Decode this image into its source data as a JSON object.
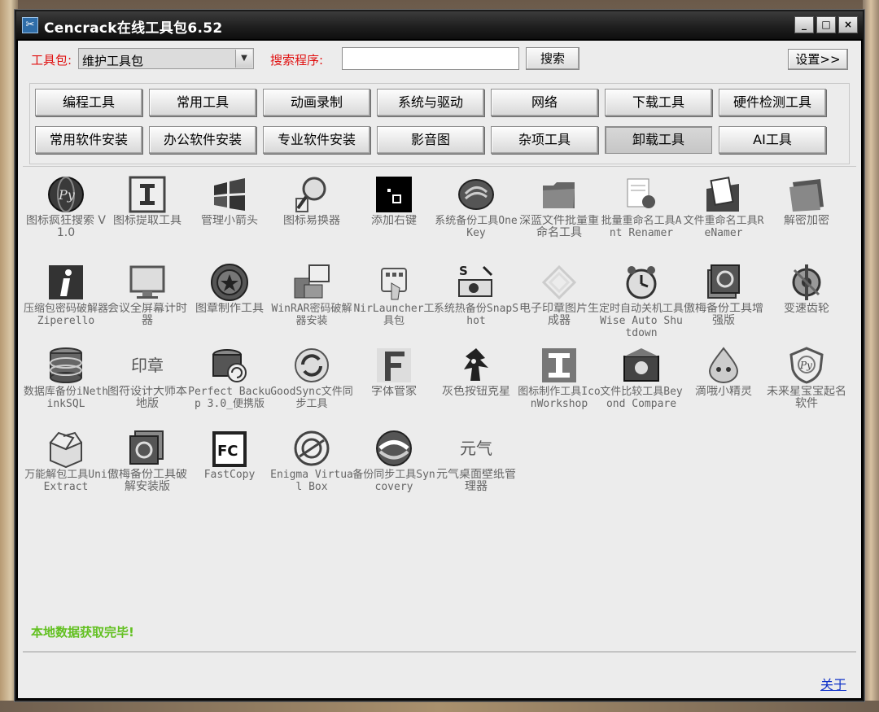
{
  "window": {
    "title": "Cencrack在线工具包6.52",
    "buttons": [
      "_",
      "□",
      "×"
    ]
  },
  "toolbar": {
    "package_label": "工具包:",
    "package_value": "维护工具包",
    "search_label": "搜索程序:",
    "search_value": "",
    "search_button": "搜索",
    "settings_button": "设置>>"
  },
  "categories": {
    "row1": [
      "编程工具",
      "常用工具",
      "动画录制",
      "系统与驱动",
      "网络",
      "下载工具",
      "硬件检测工具"
    ],
    "row2": [
      "常用软件安装",
      "办公软件安装",
      "专业软件安装",
      "影音图",
      "杂项工具",
      "卸载工具",
      "AI工具"
    ],
    "active": "卸载工具"
  },
  "tools": [
    {
      "label": "图标疯狂搜索 V1.0",
      "icon": "globe-py-icon"
    },
    {
      "label": "图标提取工具",
      "icon": "i-beam-icon"
    },
    {
      "label": "管理小箭头",
      "icon": "windows-logo-icon"
    },
    {
      "label": "图标易换器",
      "icon": "magnifier-icon"
    },
    {
      "label": "添加右键",
      "icon": "black-square-icon"
    },
    {
      "label": "系统备份工具OneKey",
      "icon": "disc-icon"
    },
    {
      "label": "深蓝文件批量重命名工具",
      "icon": "folder-icon"
    },
    {
      "label": "批量重命名工具Ant Renamer",
      "icon": "ant-icon"
    },
    {
      "label": "文件重命名工具ReNamer",
      "icon": "folder-docs-icon"
    },
    {
      "label": "解密加密",
      "icon": "dark-folder-icon"
    },
    {
      "label": "压缩包密码破解器Ziperello",
      "icon": "info-i-icon"
    },
    {
      "label": "会议全屏幕计时器",
      "icon": "monitor-icon"
    },
    {
      "label": "图章制作工具",
      "icon": "seal-icon"
    },
    {
      "label": "WinRAR密码破解器安装",
      "icon": "computer-box-icon"
    },
    {
      "label": "NirLauncher工具包",
      "icon": "hand-pointer-icon"
    },
    {
      "label": "系统热备份SnapShot",
      "icon": "camera-s-icon"
    },
    {
      "label": "电子印章图片生成器",
      "icon": "faint-stamp-icon"
    },
    {
      "label": "定时自动关机工具 Wise Auto Shutdown",
      "icon": "alarm-clock-icon"
    },
    {
      "label": "傲梅备份工具增强版",
      "icon": "backup-box-icon"
    },
    {
      "label": "变速齿轮",
      "icon": "gear-wheel-icon"
    },
    {
      "label": "数据库备份iNethinkSQL",
      "icon": "database-icon"
    },
    {
      "label": "图符设计大师本地版",
      "icon": "seal-text-icon",
      "glyph": "印章"
    },
    {
      "label": "Perfect Backup 3.0_便携版",
      "icon": "db-refresh-icon"
    },
    {
      "label": "GoodSync文件同步工具",
      "icon": "sync-icon"
    },
    {
      "label": "字体管家",
      "icon": "letter-f-icon"
    },
    {
      "label": "灰色按钮克星",
      "icon": "sonic-icon"
    },
    {
      "label": "图标制作工具IconWorkshop",
      "icon": "i-block-icon"
    },
    {
      "label": "文件比较工具Beyond Compare",
      "icon": "compare-box-icon"
    },
    {
      "label": "滴哦小精灵",
      "icon": "drop-sprite-icon"
    },
    {
      "label": "未来星宝宝起名软件",
      "icon": "shield-py-icon"
    },
    {
      "label": "万能解包工具UniExtract",
      "icon": "open-box-icon"
    },
    {
      "label": "傲梅备份工具破解安装版",
      "icon": "backup-square-icon"
    },
    {
      "label": "FastCopy",
      "icon": "fc-icon"
    },
    {
      "label": "Enigma Virtual Box",
      "icon": "enigma-icon"
    },
    {
      "label": "备份同步工具Syncovery",
      "icon": "syncovery-icon"
    },
    {
      "label": "元气桌面壁纸管理器",
      "icon": "yuanqi-icon",
      "glyph": "元气"
    }
  ],
  "status": {
    "text": "本地数据获取完毕!"
  },
  "footer": {
    "about": "关于"
  }
}
